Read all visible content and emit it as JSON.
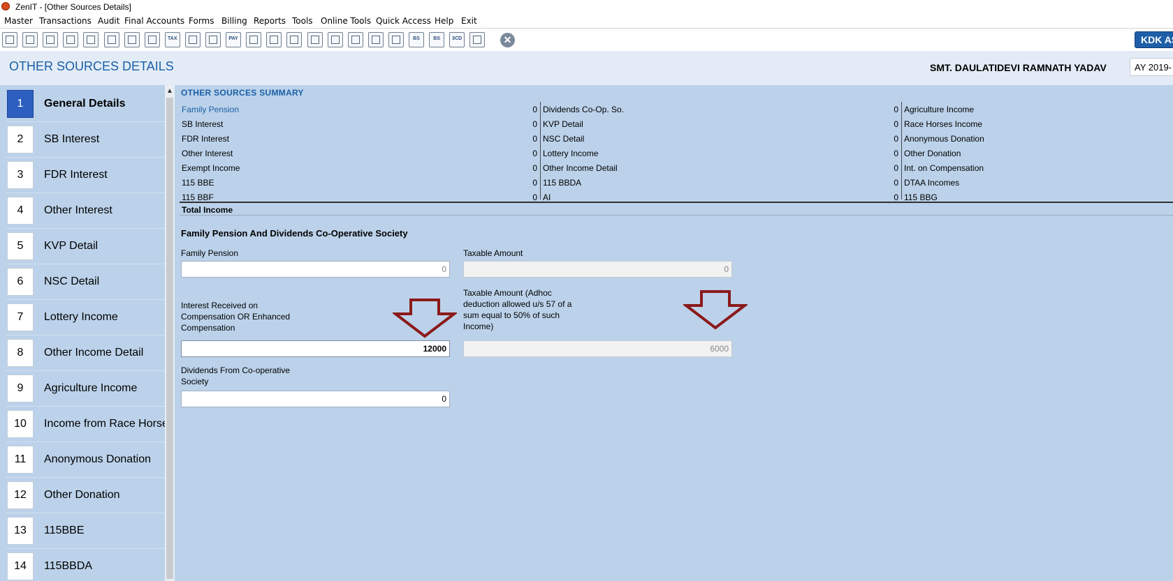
{
  "window": {
    "title": "ZenIT - [Other Sources Details]"
  },
  "menu": [
    "Master",
    "Transactions",
    "Audit",
    "Final Accounts",
    "Forms",
    "Billing",
    "Reports",
    "Tools",
    "Online Tools",
    "Quick Access",
    "Help",
    "Exit"
  ],
  "toolbar": {
    "icons": [
      "rupee-icon",
      "home-icon",
      "building-icon",
      "bar-chart-icon",
      "gift-icon",
      "users-icon",
      "tools-icon",
      "filter-icon",
      "tax-icon",
      "calculator-icon",
      "pie-chart-icon",
      "pay-icon",
      "book-icon",
      "notebook-icon",
      "info-icon",
      "report-icon",
      "calendar-icon",
      "user-doc-icon",
      "folder-add-icon",
      "refresh-icon",
      "bs-icon",
      "bs-sch-icon",
      "3cd-icon",
      "grid-doc-icon",
      "close-icon"
    ],
    "text_badges": {
      "tax-icon": "TAX",
      "pay-icon": "PAY",
      "bs-icon": "BS",
      "bs-sch-icon": "BS",
      "3cd-icon": "3CD"
    },
    "brand_button": "KDK AS"
  },
  "header": {
    "title": "OTHER SOURCES DETAILS",
    "assessee": "SMT. DAULATIDEVI RAMNATH YADAV",
    "ay": "AY 2019-"
  },
  "sidebar": {
    "items": [
      {
        "num": "1",
        "label": "General Details",
        "active": true
      },
      {
        "num": "2",
        "label": "SB Interest"
      },
      {
        "num": "3",
        "label": "FDR Interest"
      },
      {
        "num": "4",
        "label": "Other Interest"
      },
      {
        "num": "5",
        "label": "KVP Detail"
      },
      {
        "num": "6",
        "label": "NSC Detail"
      },
      {
        "num": "7",
        "label": "Lottery Income"
      },
      {
        "num": "8",
        "label": "Other Income Detail"
      },
      {
        "num": "9",
        "label": "Agriculture Income"
      },
      {
        "num": "10",
        "label": "Income from Race Horse"
      },
      {
        "num": "11",
        "label": "Anonymous Donation"
      },
      {
        "num": "12",
        "label": "Other Donation"
      },
      {
        "num": "13",
        "label": "115BBE"
      },
      {
        "num": "14",
        "label": "115BBDA"
      }
    ]
  },
  "summary": {
    "title": "OTHER SOURCES SUMMARY",
    "columns": [
      [
        {
          "label": "Family Pension",
          "value": "0",
          "highlight": true
        },
        {
          "label": "SB Interest",
          "value": "0"
        },
        {
          "label": "FDR Interest",
          "value": "0"
        },
        {
          "label": "Other Interest",
          "value": "0"
        },
        {
          "label": "Exempt Income",
          "value": "0"
        },
        {
          "label": "115 BBE",
          "value": "0"
        },
        {
          "label": "115 BBF",
          "value": "0"
        }
      ],
      [
        {
          "label": "Dividends Co-Op. So.",
          "value": "0"
        },
        {
          "label": "KVP Detail",
          "value": "0"
        },
        {
          "label": "NSC Detail",
          "value": "0"
        },
        {
          "label": "Lottery Income",
          "value": "0"
        },
        {
          "label": "Other Income Detail",
          "value": "0"
        },
        {
          "label": "115 BBDA",
          "value": "0"
        },
        {
          "label": "AI",
          "value": "0"
        }
      ],
      [
        {
          "label": "Agriculture Income",
          "value": ""
        },
        {
          "label": "Race Horses Income",
          "value": ""
        },
        {
          "label": "Anonymous Donation",
          "value": ""
        },
        {
          "label": "Other Donation",
          "value": ""
        },
        {
          "label": "Int. on Compensation",
          "value": ""
        },
        {
          "label": "DTAA Incomes",
          "value": ""
        },
        {
          "label": "115 BBG",
          "value": ""
        }
      ]
    ],
    "total_label": "Total Income"
  },
  "form": {
    "heading": "Family Pension And Dividends Co-Operative Society",
    "family_pension_label": "Family Pension",
    "family_pension_value": "0",
    "taxable_amount_label": "Taxable Amount",
    "taxable_amount_value": "0",
    "interest_label": "Interest Received on Compensation OR Enhanced Compensation",
    "interest_value": "12000",
    "taxable_adhoc_label": "Taxable Amount (Adhoc deduction allowed u/s 57 of a sum equal to 50% of such Income)",
    "taxable_adhoc_value": "6000",
    "dividends_label": "Dividends From Co-operative Society",
    "dividends_value": "0"
  },
  "colors": {
    "accent": "#1a5fa6",
    "panel": "#bcd2ea",
    "active_item": "#2c5fc0",
    "annotation_arrow": "#8b1a1a"
  }
}
